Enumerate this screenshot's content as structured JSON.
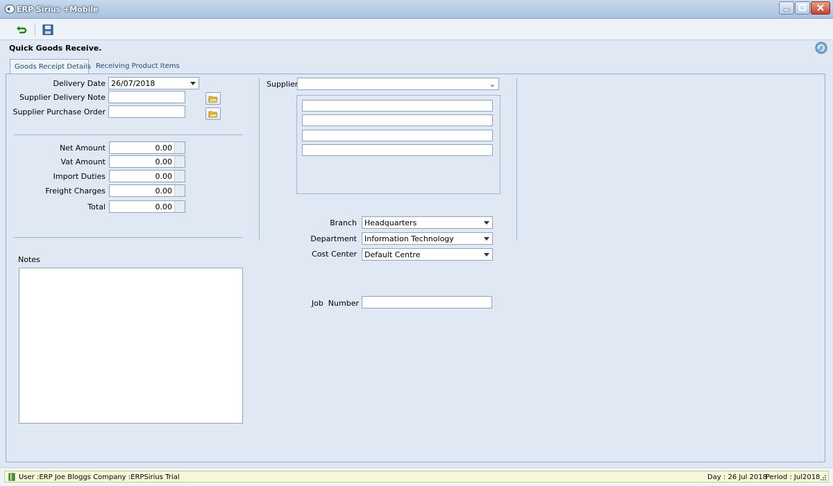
{
  "window": {
    "title": "ERP Sirius +Mobile"
  },
  "toolbar": {
    "back_icon": "green-return-arrow-icon",
    "save_icon": "floppy-disk-icon"
  },
  "page": {
    "heading": "Quick Goods Receive."
  },
  "tabs": [
    {
      "label": "Goods Receipt Details",
      "active": true
    },
    {
      "label": "Receiving Product Items",
      "active": false
    }
  ],
  "form": {
    "delivery_date": {
      "label": "Delivery Date",
      "value": "26/07/2018"
    },
    "supplier_delivery_note": {
      "label": "Supplier Delivery Note",
      "value": ""
    },
    "supplier_purchase_order": {
      "label": "Supplier Purchase Order",
      "value": ""
    },
    "net_amount": {
      "label": "Net Amount",
      "value": "0.00"
    },
    "vat_amount": {
      "label": "Vat Amount",
      "value": "0.00"
    },
    "import_duties": {
      "label": "Import Duties",
      "value": "0.00"
    },
    "freight_charges": {
      "label": "Freight Charges",
      "value": "0.00"
    },
    "total": {
      "label": "Total",
      "value": "0.00"
    },
    "notes": {
      "label": "Notes",
      "value": ""
    },
    "supplier": {
      "label": "Supplier",
      "value": ""
    },
    "branch": {
      "label": "Branch",
      "value": "Headquarters"
    },
    "department": {
      "label": "Department",
      "value": "Information Technology"
    },
    "cost_center": {
      "label": "Cost Center",
      "value": "Default Centre"
    },
    "job_number": {
      "label": "Job  Number",
      "value": ""
    }
  },
  "status": {
    "user": "User :ERP Joe Bloggs",
    "company": "Company :ERPSirius Trial",
    "day": "Day : 26 Jul 2018",
    "period": "Period : Jul2018"
  }
}
